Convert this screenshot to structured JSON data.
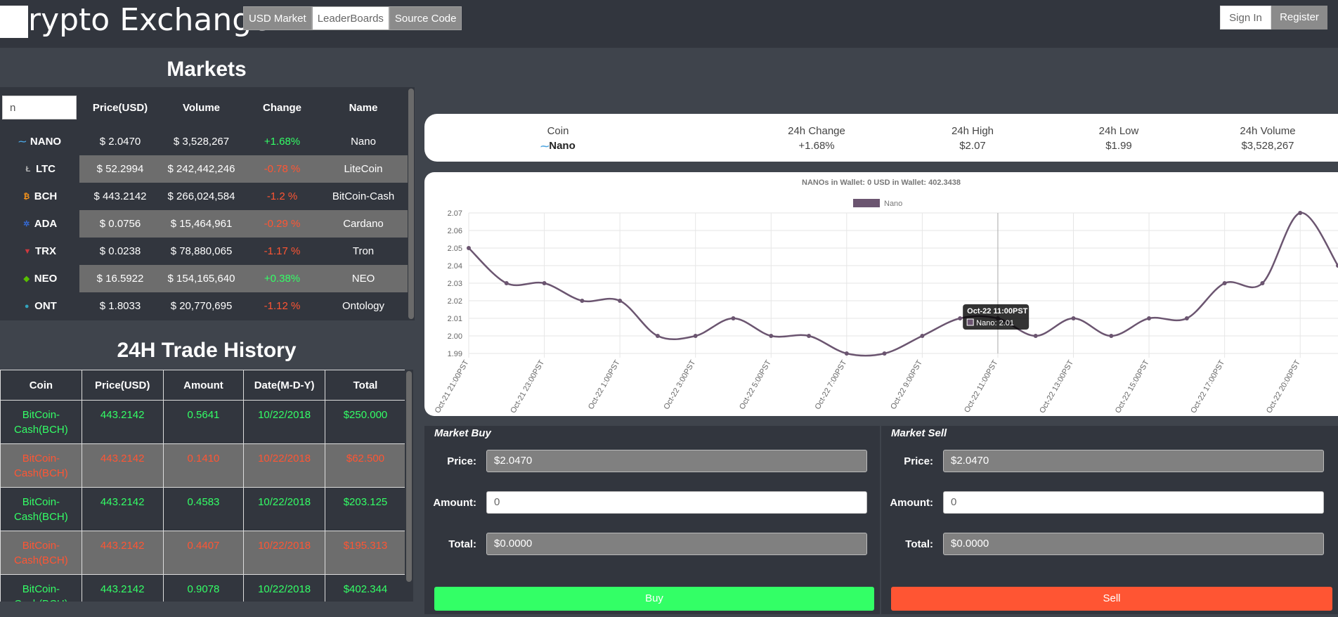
{
  "header": {
    "brand": "rypto Exchange",
    "nav": [
      "USD Market",
      "LeaderBoards",
      "Source Code"
    ],
    "sign_in": "Sign In",
    "register": "Register"
  },
  "markets": {
    "title": "Markets",
    "search_value": "n",
    "columns": [
      "Price(USD)",
      "Volume",
      "Change",
      "Name"
    ],
    "rows": [
      {
        "symbol": "NANO",
        "price": "$ 2.0470",
        "volume": "$ 3,528,267",
        "change": "+1.68%",
        "name": "Nano",
        "direction": "up",
        "icon": "nano-icon",
        "color": "#4aa3df"
      },
      {
        "symbol": "LTC",
        "price": "$ 52.2994",
        "volume": "$ 242,442,246",
        "change": "-0.78 %",
        "name": "LiteCoin",
        "direction": "down",
        "icon": "litecoin-icon",
        "color": "#bbbbbb"
      },
      {
        "symbol": "BCH",
        "price": "$ 443.2142",
        "volume": "$ 266,024,584",
        "change": "-1.2 %",
        "name": "BitCoin-Cash",
        "direction": "down",
        "icon": "bitcoin-cash-icon",
        "color": "#f7931a"
      },
      {
        "symbol": "ADA",
        "price": "$ 0.0756",
        "volume": "$ 15,464,961",
        "change": "-0.29 %",
        "name": "Cardano",
        "direction": "down",
        "icon": "cardano-icon",
        "color": "#3468d1"
      },
      {
        "symbol": "TRX",
        "price": "$ 0.0238",
        "volume": "$ 78,880,065",
        "change": "-1.17 %",
        "name": "Tron",
        "direction": "down",
        "icon": "tron-icon",
        "color": "#d0393e"
      },
      {
        "symbol": "NEO",
        "price": "$ 16.5922",
        "volume": "$ 154,165,640",
        "change": "+0.38%",
        "name": "NEO",
        "direction": "up",
        "icon": "neo-icon",
        "color": "#58bf00"
      },
      {
        "symbol": "ONT",
        "price": "$ 1.8033",
        "volume": "$ 20,770,695",
        "change": "-1.12 %",
        "name": "Ontology",
        "direction": "down",
        "icon": "ontology-icon",
        "color": "#32a4be"
      }
    ]
  },
  "history": {
    "title": "24H Trade History",
    "columns": [
      "Coin",
      "Price(USD)",
      "Amount",
      "Date(M-D-Y)",
      "Total"
    ],
    "rows": [
      {
        "coin": "BitCoin-Cash(BCH)",
        "price": "443.2142",
        "amount": "0.5641",
        "date": "10/22/2018",
        "total": "$250.000",
        "side": "buy"
      },
      {
        "coin": "BitCoin-Cash(BCH)",
        "price": "443.2142",
        "amount": "0.1410",
        "date": "10/22/2018",
        "total": "$62.500",
        "side": "sell"
      },
      {
        "coin": "BitCoin-Cash(BCH)",
        "price": "443.2142",
        "amount": "0.4583",
        "date": "10/22/2018",
        "total": "$203.125",
        "side": "buy"
      },
      {
        "coin": "BitCoin-Cash(BCH)",
        "price": "443.2142",
        "amount": "0.4407",
        "date": "10/22/2018",
        "total": "$195.313",
        "side": "sell"
      },
      {
        "coin": "BitCoin-Cash(BCH)",
        "price": "443.2142",
        "amount": "0.9078",
        "date": "10/22/2018",
        "total": "$402.344",
        "side": "buy"
      }
    ]
  },
  "stats": {
    "coin_label": "Coin",
    "coin_value": "Nano",
    "change_label": "24h Change",
    "change_value": "+1.68%",
    "high_label": "24h High",
    "high_value": "$2.07",
    "low_label": "24h Low",
    "low_value": "$1.99",
    "volume_label": "24h Volume",
    "volume_value": "$3,528,267"
  },
  "chart_data": {
    "type": "line",
    "title": "NANOs in Wallet: 0     USD in Wallet: 402.3438",
    "series": [
      {
        "name": "Nano",
        "color": "#6b5570",
        "values": [
          2.05,
          2.03,
          2.03,
          2.02,
          2.02,
          2.0,
          2.0,
          2.01,
          2.0,
          2.0,
          1.99,
          1.99,
          2.0,
          2.01,
          2.01,
          2.0,
          2.01,
          2.0,
          2.01,
          2.01,
          2.03,
          2.03,
          2.07,
          2.04
        ]
      }
    ],
    "x_tick_labels": [
      "Oct-21 21:00PST",
      "Oct-21 23:00PST",
      "Oct-22 1:00PST",
      "Oct-22 3:00PST",
      "Oct-22 5:00PST",
      "Oct-22 7:00PST",
      "Oct-22 9:00PST",
      "Oct-22 11:00PST",
      "Oct-22 13:00PST",
      "Oct-22 15:00PST",
      "Oct-22 17:00PST",
      "Oct-22 20:00PST"
    ],
    "y_ticks": [
      "2.07",
      "2.06",
      "2.05",
      "2.04",
      "2.03",
      "2.02",
      "2.01",
      "2.00",
      "1.99"
    ],
    "ylim": [
      1.99,
      2.07
    ],
    "legend": "top",
    "grid": true,
    "tooltip": {
      "title": "Oct-22 11:00PST",
      "body": "Nano: 2.01"
    }
  },
  "buy_panel": {
    "title": "Market Buy",
    "price_label": "Price:",
    "price_value": "$2.0470",
    "amount_label": "Amount:",
    "amount_placeholder": "0",
    "total_label": "Total:",
    "total_value": "$0.0000",
    "button": "Buy",
    "button_color": "#33ff66"
  },
  "sell_panel": {
    "title": "Market Sell",
    "price_label": "Price:",
    "price_value": "$2.0470",
    "amount_label": "Amount:",
    "amount_placeholder": "0",
    "total_label": "Total:",
    "total_value": "$0.0000",
    "button": "Sell",
    "button_color": "#ff5533"
  }
}
